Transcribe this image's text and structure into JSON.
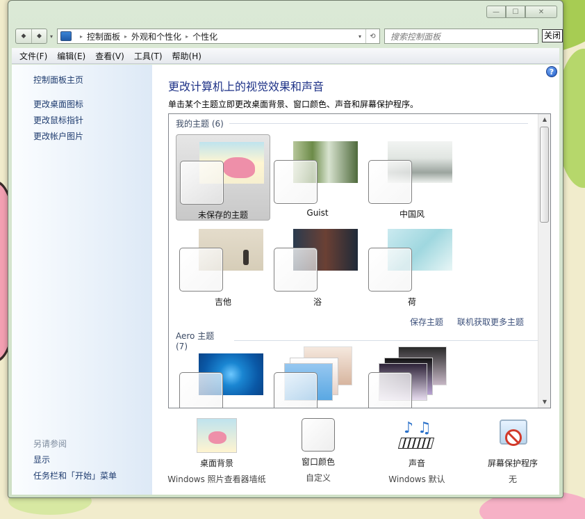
{
  "window": {
    "caption": {
      "minimize": "—",
      "maximize": "☐",
      "close": "✕"
    },
    "nav": {
      "back": "◆",
      "forward": "◆",
      "dropdown": "▾"
    },
    "address": {
      "crumbs": [
        "控制面板",
        "外观和个性化",
        "个性化"
      ],
      "separator": "▸",
      "drop": "▾",
      "refresh": "⟲"
    },
    "search": {
      "placeholder": "搜索控制面板"
    },
    "close_label": "关闭"
  },
  "menu": [
    "文件(F)",
    "编辑(E)",
    "查看(V)",
    "工具(T)",
    "帮助(H)"
  ],
  "sidebar": {
    "home": "控制面板主页",
    "links": [
      "更改桌面图标",
      "更改鼠标指针",
      "更改帐户图片"
    ],
    "see_also": "另请参阅",
    "see_also_links": [
      "显示",
      "任务栏和「开始」菜单"
    ]
  },
  "main": {
    "help": "?",
    "title": "更改计算机上的视觉效果和声音",
    "description": "单击某个主题立即更改桌面背景、窗口颜色、声音和屏幕保护程序。",
    "my_themes": {
      "heading": "我的主题 (6)",
      "themes": [
        "未保存的主题",
        "Guist",
        "中国风",
        "吉他",
        "浴",
        "荷"
      ],
      "selected": "未保存的主题"
    },
    "save_theme": "保存主题",
    "get_more": "联机获取更多主题",
    "aero_themes": {
      "heading": "Aero 主题 (7)"
    },
    "scroll": {
      "up": "▲",
      "down": "▼"
    }
  },
  "bottom": {
    "desktop_background": {
      "title": "桌面背景",
      "value": "Windows 照片查看器墙纸"
    },
    "window_color": {
      "title": "窗口颜色",
      "value": "自定义"
    },
    "sounds": {
      "title": "声音",
      "value": "Windows 默认",
      "note1": "♪",
      "note2": "♫"
    },
    "screen_saver": {
      "title": "屏幕保护程序",
      "value": "无"
    }
  }
}
